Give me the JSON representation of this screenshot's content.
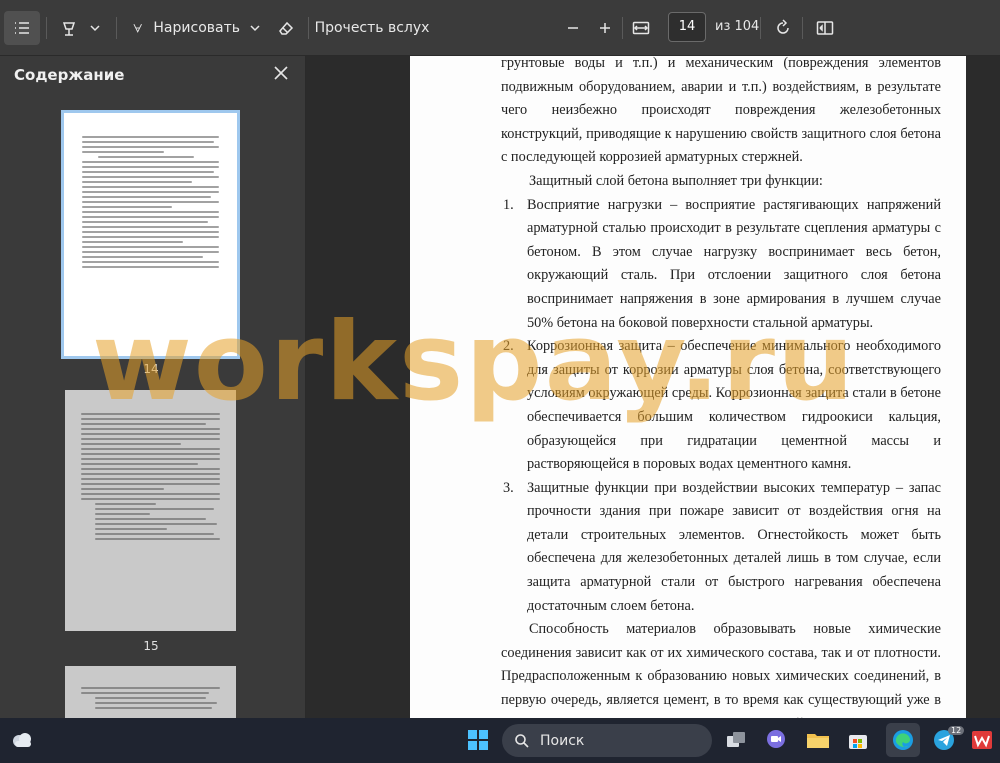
{
  "toolbar": {
    "draw_label": "Нарисовать",
    "read_aloud_label": "Прочесть вслух",
    "page_current": "14",
    "page_total_label": "из 104"
  },
  "sidebar": {
    "title": "Содержание",
    "thumbnails": [
      {
        "page": "14",
        "selected": true
      },
      {
        "page": "15",
        "selected": false
      }
    ]
  },
  "document": {
    "para1": "грунтовые воды и т.п.) и механическим (повреждения элементов подвижным оборудованием, аварии и т.п.) воздействиям, в результате чего неизбежно происходят повреждения железобетонных конструкций, приводящие к нарушению свойств защитного слоя бетона с последующей коррозией арматурных стержней.",
    "para2": "Защитный слой бетона выполняет три функции:",
    "items": [
      {
        "num": "1.",
        "text": "Восприятие нагрузки – восприятие растягивающих напряжений арматурной сталью происходит в результате сцепления арматуры с бетоном. В этом случае нагрузку воспринимает весь бетон, окружающий сталь. При отслоении защитного слоя бетона воспринимает напряжения в зоне армирования в лучшем случае 50% бетона на боковой поверхности стальной арматуры."
      },
      {
        "num": "2.",
        "text": "Коррозионная защита – обеспечение минимального необходимого для защиты от коррозии арматуры слоя бетона, соответствующего условиям окружающей среды. Коррозионная защита стали в бетоне обеспечивается большим количеством гидроокиси кальция, образующейся при гидратации цементной массы и растворяющейся в поровых водах цементного камня."
      },
      {
        "num": "3.",
        "text": "Защитные функции при воздействии высоких температур – запас прочности здания при пожаре зависит от воздействия огня на детали строительных элементов. Огнестойкость может быть обеспечена для железобетонных деталей лишь в том случае, если защита арматурной стали от быстрого нагревания обеспечена достаточным слоем бетона."
      }
    ],
    "para3": "Способность материалов образовывать новые химические соединения зависит как от их химического состава, так и от плотности. Предрасположенным к образованию новых химических соединений, в первую очередь, является цемент, в то время как существующий уже в течение многих миллионов лет естественный камень значительно меньше расположен к этому. Цементный камень особенно чувствителен к кислотным воздей-"
  },
  "watermark": "workspay.ru",
  "taskbar": {
    "search_label": "Поиск",
    "badge_count": "12"
  }
}
